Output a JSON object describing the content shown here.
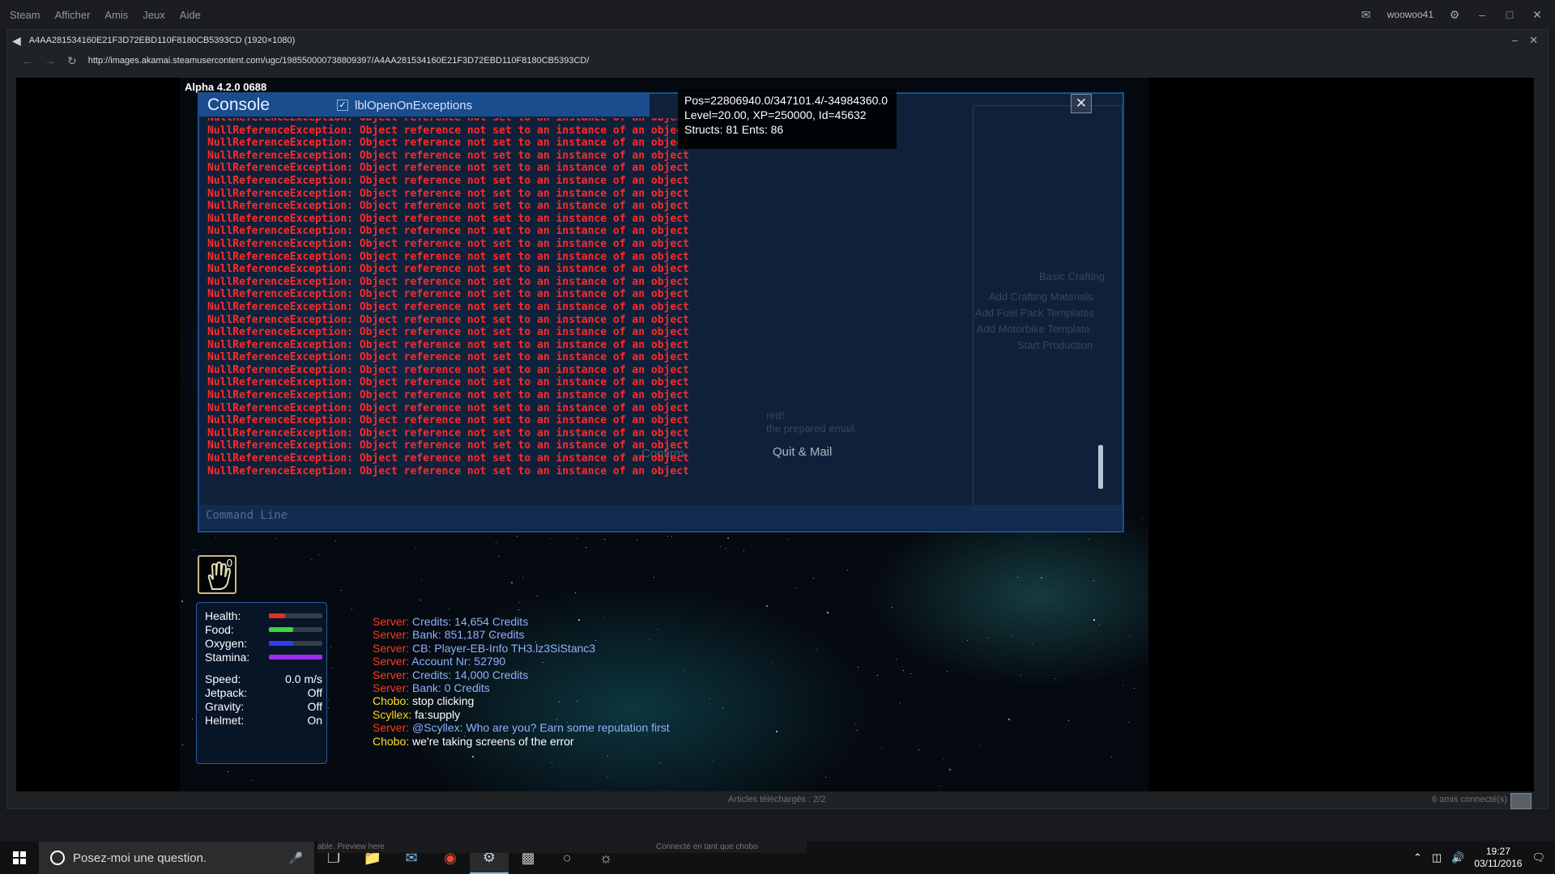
{
  "steam_menu": {
    "items": [
      "Steam",
      "Afficher",
      "Amis",
      "Jeux",
      "Aide"
    ],
    "username": "woowoo41"
  },
  "browser": {
    "title": "A4AA281534160E21F3D72EBD110F8180CB5393CD (1920×1080)",
    "url": "http://images.akamai.steamusercontent.com/ugc/198550000738809397/A4AA281534160E21F3D72EBD110F8180CB5393CD/",
    "downloads": "Articles téléchargés : 2/2",
    "friends": "6 amis connecté(s)"
  },
  "game": {
    "version": "Alpha 4.2.0 0688",
    "console": {
      "title": "Console",
      "checkbox_label": "lblOpenOnExceptions",
      "checked": true,
      "exception_line": "NullReferenceException: Object reference not set to an instance of an object",
      "command_placeholder": "Command Line"
    },
    "position_info": {
      "line1": "Pos=22806940.0/347101.4/-34984360.0",
      "line2": "Level=20.00, XP=250000, Id=45632",
      "line3": "Structs: 81 Ents: 86"
    },
    "background_ui": {
      "crafting_title": "Basic Crafting",
      "crafting_items": [
        "Add Crafting Materials",
        "Add Fuel Pack Templates",
        "Add Motorbike Template",
        "Start Production"
      ],
      "dialog_line1": "red!.",
      "dialog_line2": "the prepared email.",
      "confirm_label": "Confirm",
      "quit_mail_label": "Quit & Mail"
    },
    "hotbar": {
      "count": "0"
    },
    "stats": {
      "health": {
        "label": "Health:",
        "level": 0.3,
        "color": "#e03030"
      },
      "food": {
        "label": "Food:",
        "level": 0.45,
        "color": "#3ed23e"
      },
      "oxygen": {
        "label": "Oxygen:",
        "level": 0.45,
        "color": "#2f3ff0"
      },
      "stamina": {
        "label": "Stamina:",
        "level": 1.0,
        "color": "#a02af0"
      },
      "speed": {
        "label": "Speed:",
        "value": "0.0 m/s"
      },
      "jetpack": {
        "label": "Jetpack:",
        "value": "Off"
      },
      "gravity": {
        "label": "Gravity:",
        "value": "Off"
      },
      "helmet": {
        "label": "Helmet:",
        "value": "On"
      }
    },
    "chat": [
      {
        "sender": "Server:",
        "text": "Credits: 14,654 Credits",
        "kind": "server"
      },
      {
        "sender": "Server:",
        "text": "Bank: 851,187 Credits",
        "kind": "server"
      },
      {
        "sender": "Server:",
        "text": "CB: Player-EB-Info TH3.lz3SiStanc3",
        "kind": "server"
      },
      {
        "sender": "Server:",
        "text": "Account Nr: 52790",
        "kind": "server"
      },
      {
        "sender": "Server:",
        "text": "Credits: 14,000 Credits",
        "kind": "server"
      },
      {
        "sender": "Server:",
        "text": "Bank: 0 Credits",
        "kind": "server"
      },
      {
        "sender": "Chobo:",
        "text": "stop clicking",
        "kind": "chobo"
      },
      {
        "sender": "Scyllex:",
        "text": "fa:supply",
        "kind": "scyllex"
      },
      {
        "sender": "Server:",
        "text": "@Scyllex: Who are you? Earn some reputation first",
        "kind": "server"
      },
      {
        "sender": "Chobo:",
        "text": "we're taking screens of the error",
        "kind": "chobo"
      }
    ]
  },
  "taskbar": {
    "search_placeholder": "Posez-moi une question.",
    "tooltip_left": "able. Preview here",
    "tooltip_right": "Connecté en tant que chobo",
    "time": "19:27",
    "date": "03/11/2016"
  },
  "colors": {
    "console_header": "#1a4d8e",
    "exception_text": "#ff2a2a",
    "server_sender": "#ff3a1a",
    "player_sender": "#ffe12a"
  },
  "icons": {
    "stop_hand": "hand-icon",
    "start": "windows-icon",
    "cortana": "cortana-icon"
  }
}
